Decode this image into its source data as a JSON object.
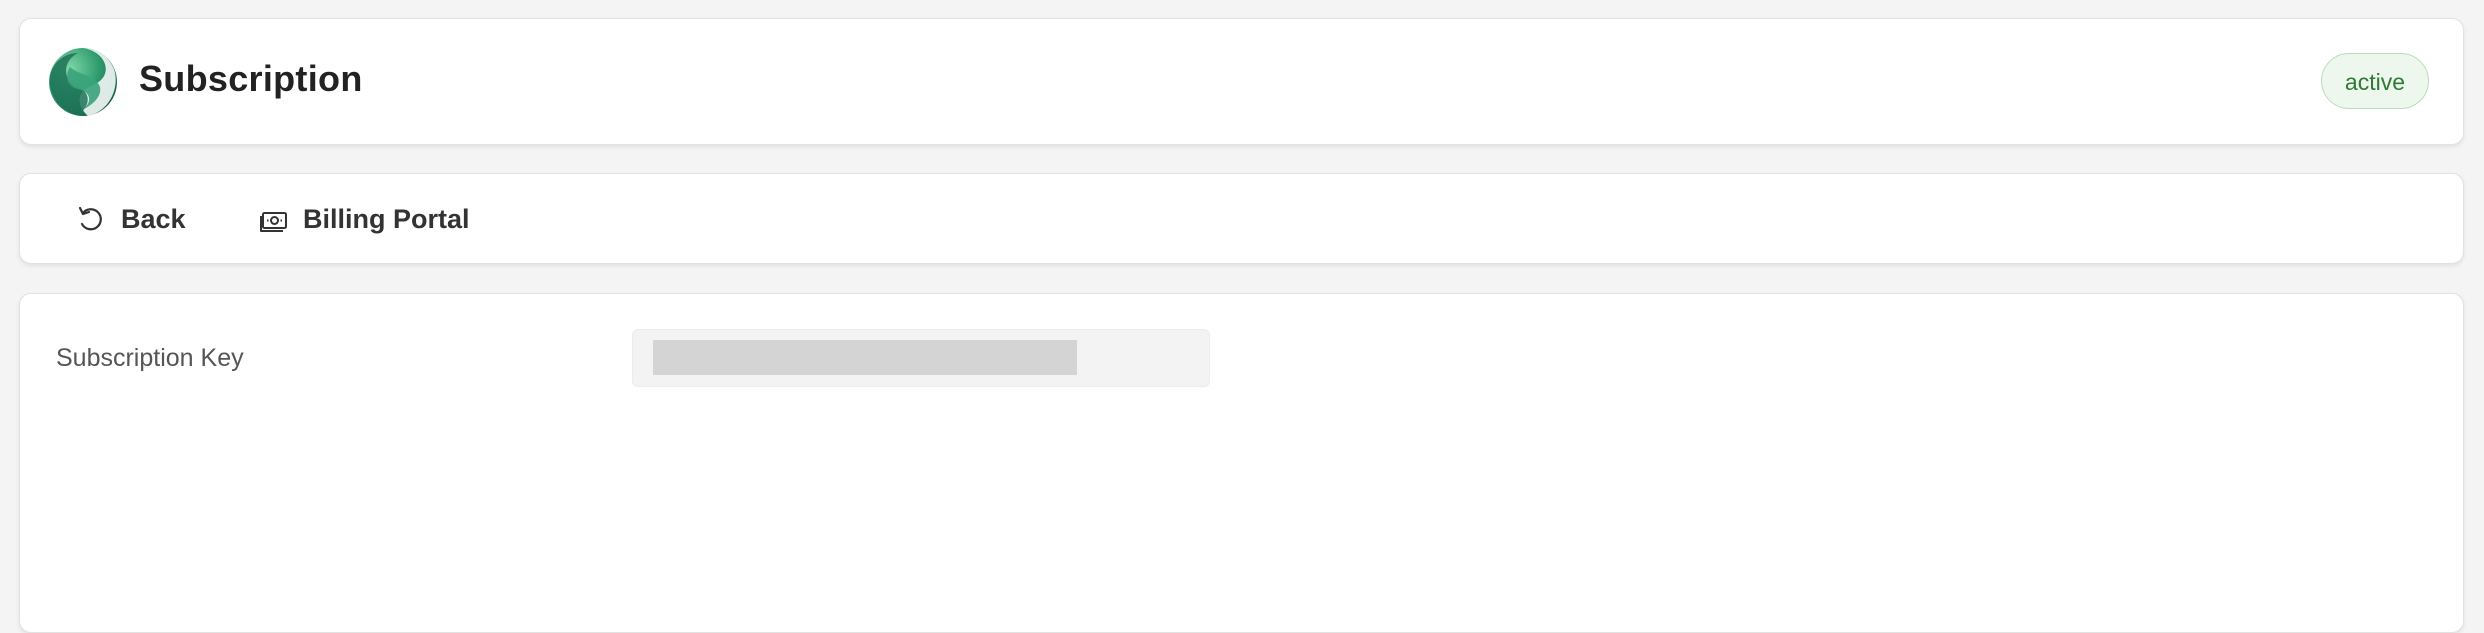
{
  "header": {
    "title": "Subscription",
    "status": "active",
    "logo_icon": "app-logo-icon"
  },
  "toolbar": {
    "back_label": "Back",
    "back_icon": "undo-arrow-icon",
    "billing_label": "Billing Portal",
    "billing_icon": "banknote-icon"
  },
  "details": {
    "subscription_key_label": "Subscription Key",
    "subscription_key_value": ""
  },
  "colors": {
    "background": "#f4f4f4",
    "card": "#ffffff",
    "status_text": "#2f7a35",
    "status_bg": "#eef7ee",
    "logo_primary": "#2f8f6a"
  }
}
